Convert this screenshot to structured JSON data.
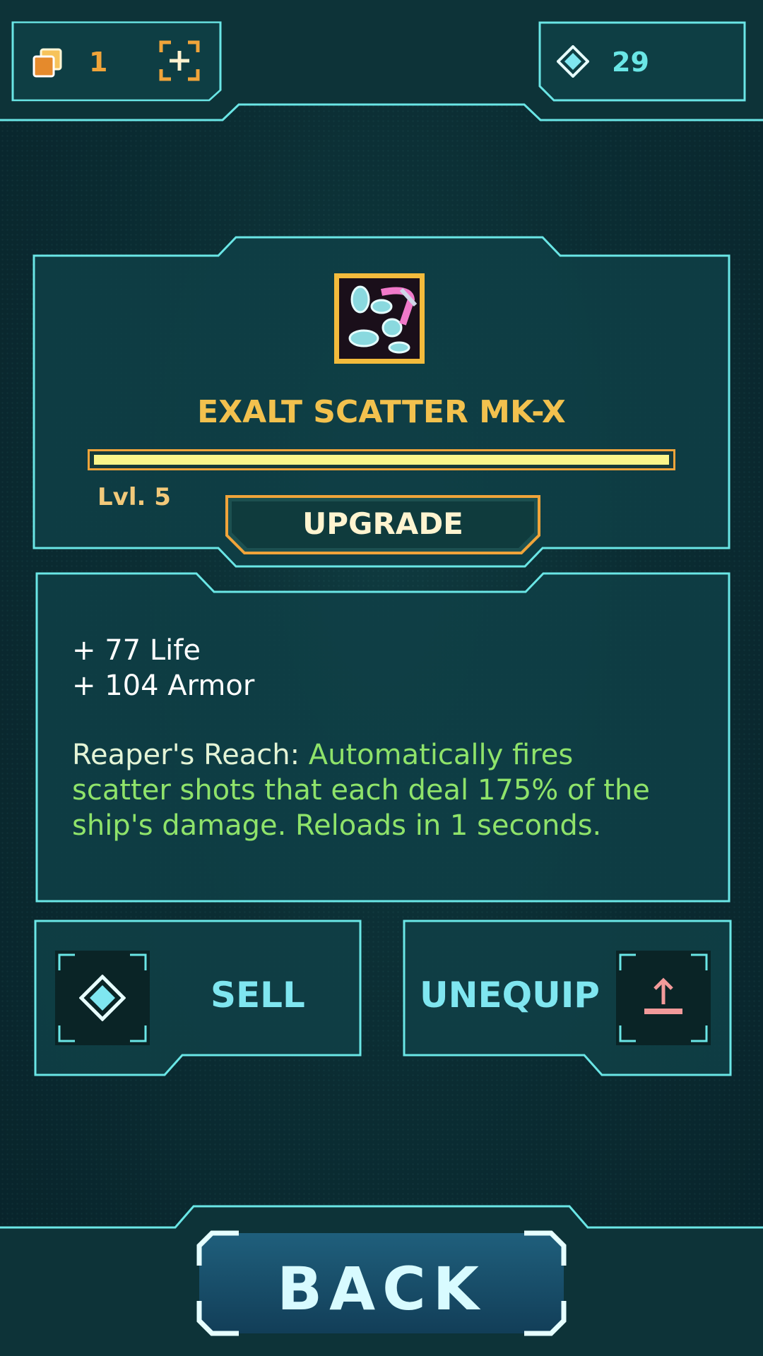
{
  "header": {
    "cards_count": "1",
    "gems_count": "29"
  },
  "item": {
    "name": "EXALT SCATTER MK-X",
    "level_label": "Lvl. 5",
    "level_progress": 1.0,
    "upgrade_label": "UPGRADE"
  },
  "stats": {
    "lines": [
      "+ 77 Life",
      "+ 104 Armor"
    ],
    "ability_name": "Reaper's Reach:",
    "ability_desc_1": "Automatically fires",
    "ability_desc_2": "scatter shots that each deal 175% of the",
    "ability_desc_3": "ship's damage. Reloads in 1 seconds."
  },
  "actions": {
    "sell_label": "SELL",
    "unequip_label": "UNEQUIP"
  },
  "footer": {
    "back_label": "BACK"
  },
  "colors": {
    "accent_cyan": "#6ae6e6",
    "gold": "#f2c14e",
    "orange": "#f0a43a",
    "ability_green": "#8fe36a",
    "bar_yellow": "#fbf58a",
    "unequip_pink": "#f29a9a"
  },
  "icons": {
    "cards": "stacked-cards-icon",
    "add": "add-bracket-icon",
    "gem": "diamond-gem-icon",
    "item": "scatter-weapon-icon",
    "sell": "diamond-gem-icon",
    "unequip": "upload-arrow-icon"
  }
}
